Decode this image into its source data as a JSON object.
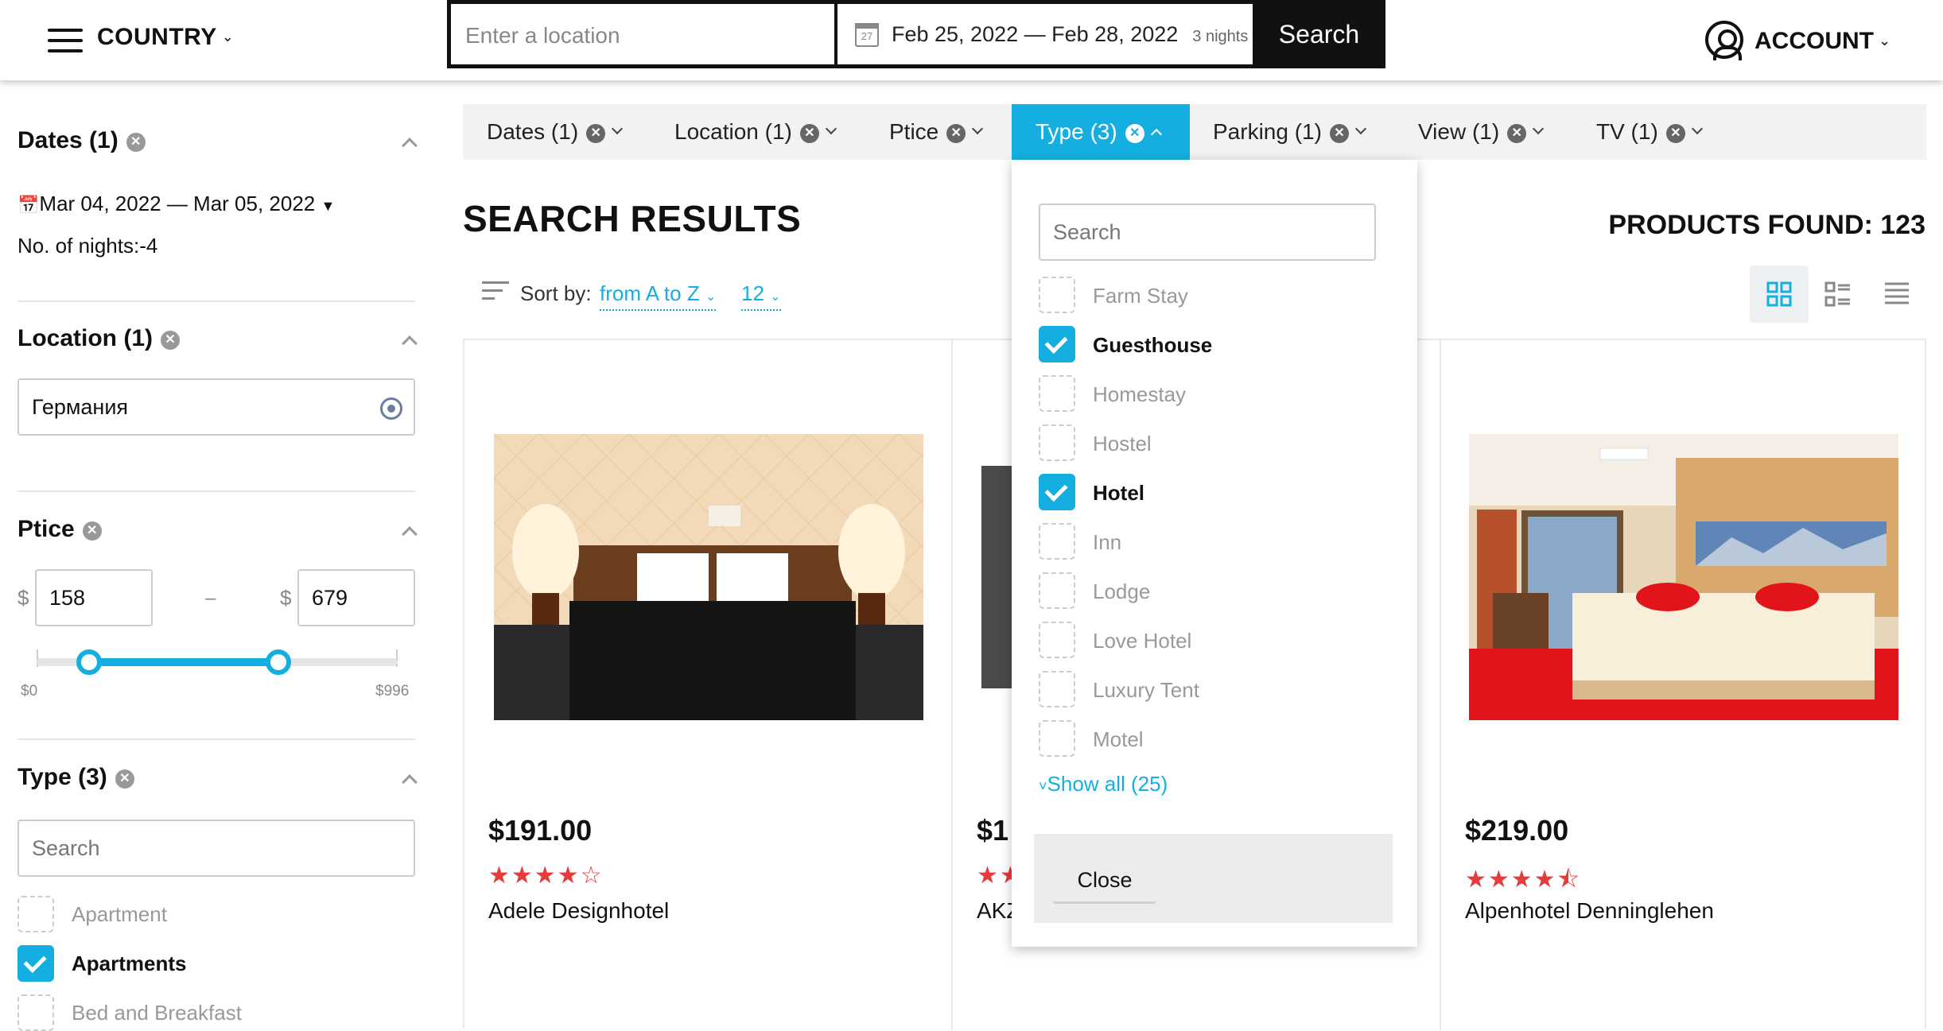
{
  "header": {
    "country_label": "COUNTRY",
    "location_placeholder": "Enter a location",
    "date_range": "Feb 25, 2022 — Feb 28, 2022",
    "nights": "3  nights",
    "search_button": "Search",
    "account_label": "ACCOUNT",
    "calendar_day": "27"
  },
  "sidebar": {
    "dates": {
      "title": "Dates (1)",
      "range": "Mar 04, 2022 — Mar 05, 2022",
      "nights": "No. of nights:-4"
    },
    "location": {
      "title": "Location (1)",
      "value": "Германия"
    },
    "price": {
      "title": "Ptice",
      "currency": "$",
      "min": "158",
      "max": "679",
      "range_min_label": "$0",
      "range_max_label": "$996",
      "range_min": 0,
      "range_max": 996
    },
    "type": {
      "title": "Type (3)",
      "search_placeholder": "Search",
      "options": [
        {
          "label": "Apartment",
          "checked": false
        },
        {
          "label": "Apartments",
          "checked": true
        },
        {
          "label": "Bed and Breakfast",
          "checked": false
        }
      ]
    }
  },
  "filter_tabs": [
    {
      "label": "Dates (1)",
      "active": false
    },
    {
      "label": "Location (1)",
      "active": false
    },
    {
      "label": "Ptice",
      "active": false
    },
    {
      "label": "Type (3)",
      "active": true
    },
    {
      "label": "Parking (1)",
      "active": false
    },
    {
      "label": "View (1)",
      "active": false
    },
    {
      "label": "TV (1)",
      "active": false
    }
  ],
  "results": {
    "title": "SEARCH RESULTS",
    "products_found": "PRODUCTS FOUND: 123",
    "sort_label": "Sort by:",
    "sort_value": "from A to Z",
    "per_page": "12"
  },
  "cards": [
    {
      "price": "$191.00",
      "rating": 4,
      "stars": "★★★★☆",
      "name": "Adele Designhotel"
    },
    {
      "price": "$1",
      "rating": 2,
      "stars": "★★",
      "name": "AKZ"
    },
    {
      "price": "$219.00",
      "rating": 4.5,
      "stars": "★★★★⯪",
      "name": "Alpenhotel Denninglehen"
    }
  ],
  "type_dropdown": {
    "search_placeholder": "Search",
    "options": [
      {
        "label": "Farm Stay",
        "checked": false
      },
      {
        "label": "Guesthouse",
        "checked": true
      },
      {
        "label": "Homestay",
        "checked": false
      },
      {
        "label": "Hostel",
        "checked": false
      },
      {
        "label": "Hotel",
        "checked": true
      },
      {
        "label": "Inn",
        "checked": false
      },
      {
        "label": "Lodge",
        "checked": false
      },
      {
        "label": "Love Hotel",
        "checked": false
      },
      {
        "label": "Luxury Tent",
        "checked": false
      },
      {
        "label": "Motel",
        "checked": false
      }
    ],
    "show_all": "Show all (25)",
    "close_button": "Close"
  },
  "colors": {
    "accent": "#14afe0",
    "star": "#e63b3b",
    "text": "#111111"
  }
}
